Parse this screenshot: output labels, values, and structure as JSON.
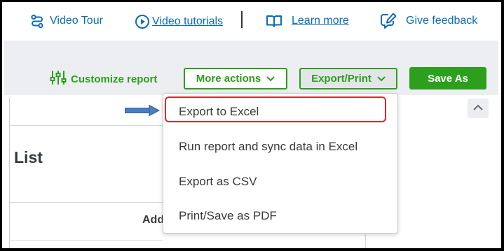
{
  "topbar": {
    "video_tour": "Video Tour",
    "video_tutorials": "Video tutorials",
    "learn_more": "Learn more",
    "give_feedback": "Give feedback"
  },
  "toolbar": {
    "customize_report": "Customize report",
    "more_actions": "More actions",
    "export_print": "Export/Print",
    "save_as": "Save As"
  },
  "report": {
    "title_fragment": "List",
    "column_fragment": "Add"
  },
  "dropdown": {
    "items": [
      {
        "label": "Export to Excel",
        "highlighted": true
      },
      {
        "label": "Run report and sync data in Excel"
      },
      {
        "label": "Export as CSV"
      },
      {
        "label": "Print/Save as PDF"
      }
    ]
  },
  "colors": {
    "brand_green": "#2ca01c",
    "link_blue": "#0a6bb8",
    "highlight_red": "#d62b2b",
    "annotation_arrow": "#4a7fc1"
  },
  "icons": [
    "route-icon",
    "play-circle-icon",
    "book-icon",
    "feedback-pencil-icon",
    "sliders-icon",
    "chevron-down-icon",
    "chevron-up-icon",
    "arrow-right-icon"
  ]
}
